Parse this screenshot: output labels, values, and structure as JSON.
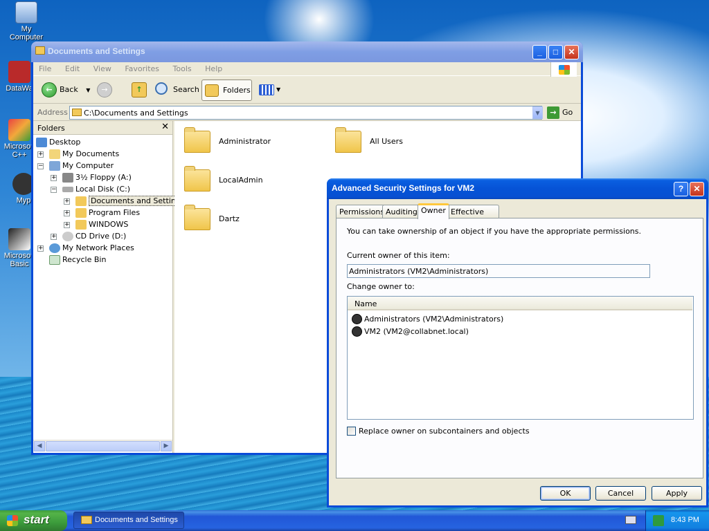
{
  "desktop": {
    "icons": [
      "My Computer",
      "DataWa",
      "Microsoft C++",
      "Myp",
      "Microsoft Basic"
    ]
  },
  "explorer": {
    "title": "Documents and Settings",
    "menu": [
      "File",
      "Edit",
      "View",
      "Favorites",
      "Tools",
      "Help"
    ],
    "toolbar": {
      "back": "Back",
      "search": "Search",
      "folders": "Folders"
    },
    "address": {
      "label": "Address",
      "value": "C:\\Documents and Settings",
      "go": "Go"
    },
    "folders_pane": {
      "title": "Folders",
      "tree": [
        "Desktop",
        "My Documents",
        "My Computer",
        "3½ Floppy (A:)",
        "Local Disk (C:)",
        "Documents and Settings",
        "Program Files",
        "WINDOWS",
        "CD Drive (D:)",
        "My Network Places",
        "Recycle Bin"
      ]
    },
    "items": [
      "Administrator",
      "All Users",
      "LocalAdmin",
      "Dartz"
    ]
  },
  "dialog": {
    "title": "Advanced Security Settings for VM2",
    "tabs": [
      "Permissions",
      "Auditing",
      "Owner",
      "Effective Permissions"
    ],
    "info": "You can take ownership of an object if you have the appropriate permissions.",
    "current_owner_label": "Current owner of this item:",
    "current_owner": "Administrators (VM2\\Administrators)",
    "change_owner_label": "Change owner to:",
    "list_header": "Name",
    "owners": [
      "Administrators (VM2\\Administrators)",
      "VM2 (VM2@collabnet.local)"
    ],
    "replace_label": "Replace owner on subcontainers and objects",
    "buttons": {
      "ok": "OK",
      "cancel": "Cancel",
      "apply": "Apply"
    }
  },
  "taskbar": {
    "start": "start",
    "task": "Documents and Settings",
    "clock": "8:43 PM"
  }
}
